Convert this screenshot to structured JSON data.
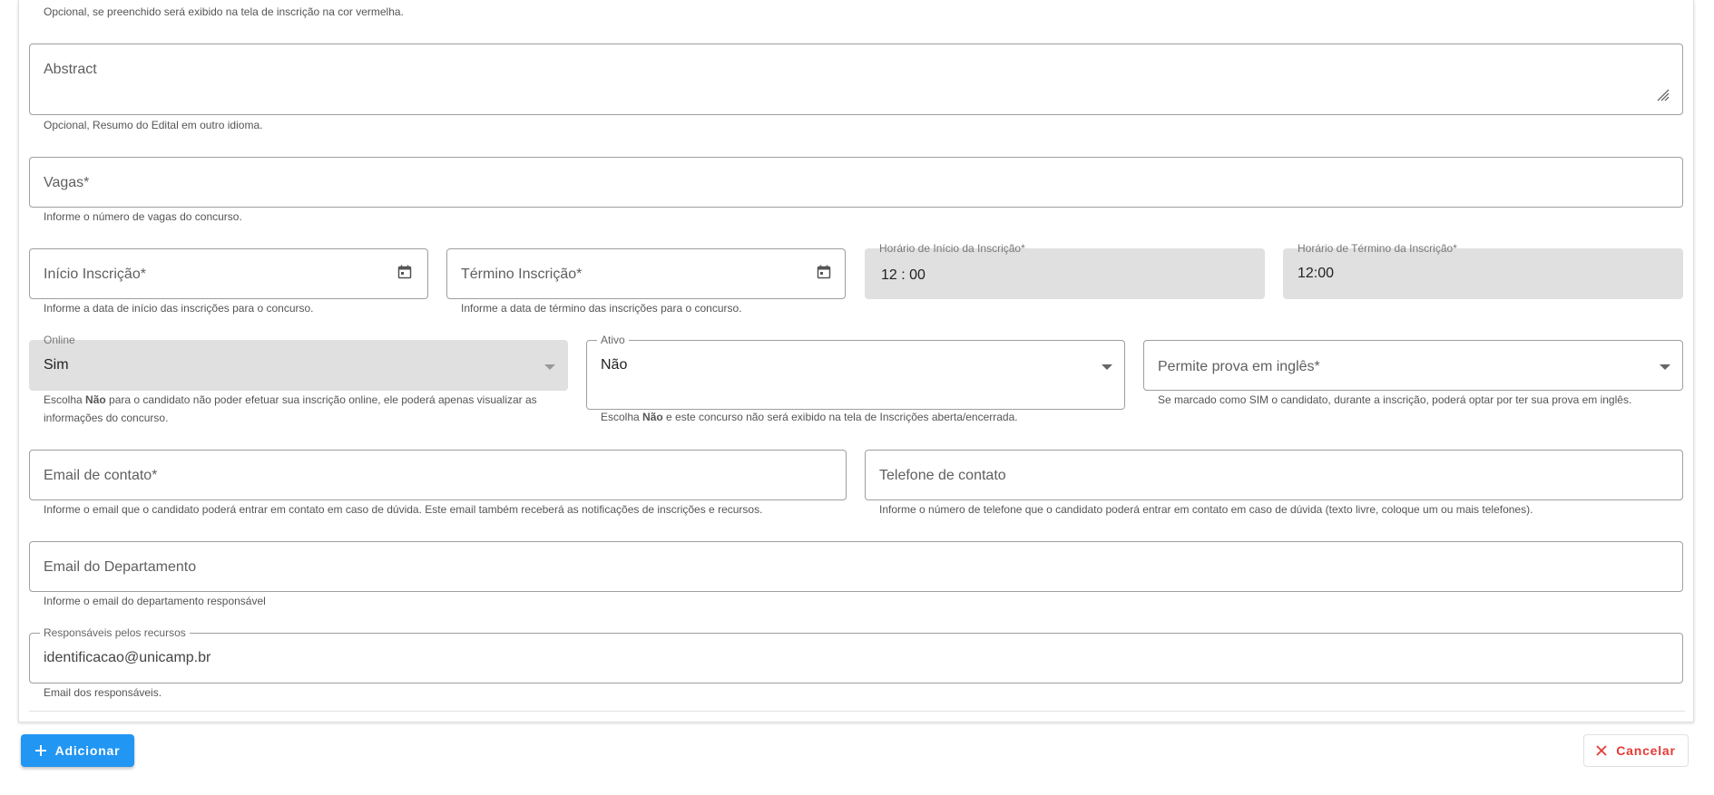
{
  "form": {
    "top_hint": "Opcional, se preenchido será exibido na tela de inscrição na cor vermelha.",
    "abstract": {
      "placeholder": "Abstract",
      "hint": "Opcional, Resumo do Edital em outro idioma."
    },
    "vagas": {
      "placeholder": "Vagas*",
      "hint": "Informe o número de vagas do concurso."
    },
    "inicio": {
      "placeholder": "Início Inscrição*",
      "hint": "Informe a data de início das inscrições para o concurso.",
      "icon": "calendar-icon"
    },
    "termino": {
      "placeholder": "Término Inscrição*",
      "hint": "Informe a data de término das inscrições para o concurso.",
      "icon": "calendar-icon"
    },
    "horario_inicio": {
      "label": "Horário de Início da Inscrição*",
      "value": "12 : 00"
    },
    "horario_termino": {
      "label": "Horário de Término da Inscrição*",
      "value": "12:00"
    },
    "online": {
      "label": "Online",
      "value": "Sim",
      "hint_prefix": "Escolha ",
      "hint_bold": "Não",
      "hint_suffix": " para o candidato não poder efetuar sua inscrição online, ele poderá apenas visualizar as informações do concurso."
    },
    "ativo": {
      "label": "Ativo",
      "value": "Não",
      "hint_prefix": "Escolha ",
      "hint_bold": "Não",
      "hint_suffix": " e este concurso não será exibido na tela de Inscrições aberta/encerrada."
    },
    "prova_ingles": {
      "placeholder": "Permite prova em inglês*",
      "hint": "Se marcado como SIM o candidato, durante a inscrição, poderá optar por ter sua prova em inglês."
    },
    "email_contato": {
      "placeholder": "Email de contato*",
      "hint": "Informe o email que o candidato poderá entrar em contato em caso de dúvida. Este email também receberá as notificações de inscrições e recursos."
    },
    "telefone": {
      "placeholder": "Telefone de contato",
      "hint": "Informe o número de telefone que o candidato poderá entrar em contato em caso de dúvida (texto livre, coloque um ou mais telefones)."
    },
    "email_departamento": {
      "placeholder": "Email do Departamento",
      "hint": "Informe o email do departamento responsável"
    },
    "responsaveis": {
      "label": "Responsáveis pelos recursos",
      "value": "identificacao@unicamp.br",
      "hint": "Email dos responsáveis."
    }
  },
  "actions": {
    "add_label": "Adicionar",
    "cancel_label": "Cancelar"
  },
  "colors": {
    "primary": "#2196f3",
    "danger": "#e53935",
    "disabled_bg": "#e0e0e0"
  }
}
